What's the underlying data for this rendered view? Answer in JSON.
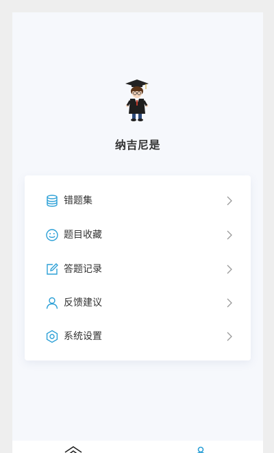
{
  "profile": {
    "name": "纳吉尼是",
    "avatar_icon": "cartoon-graduate-avatar"
  },
  "menu": {
    "items": [
      {
        "label": "错题集",
        "icon": "database-icon"
      },
      {
        "label": "题目收藏",
        "icon": "smiley-icon"
      },
      {
        "label": "答题记录",
        "icon": "edit-icon"
      },
      {
        "label": "反馈建议",
        "icon": "user-icon"
      },
      {
        "label": "系统设置",
        "icon": "settings-icon"
      }
    ],
    "chevron_icon": "chevron-right-icon"
  },
  "tabbar": {
    "tabs": [
      {
        "icon": "home-icon"
      },
      {
        "icon": "user-icon"
      }
    ],
    "accent_color": "#2a9fd6"
  }
}
